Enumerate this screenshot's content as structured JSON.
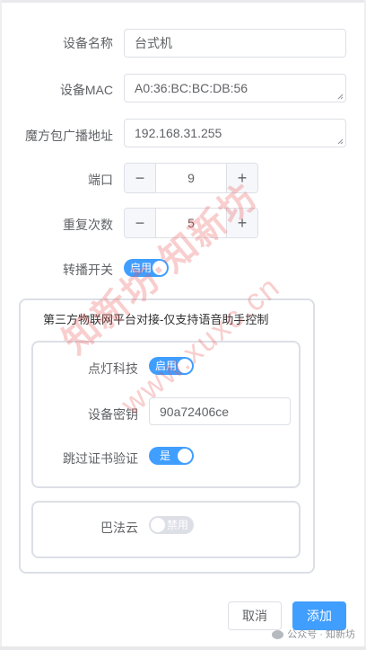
{
  "form": {
    "device_name": {
      "label": "设备名称",
      "value": "台式机"
    },
    "device_mac": {
      "label": "设备MAC",
      "value": "A0:36:BC:BC:DB:56"
    },
    "broadcast": {
      "label": "魔方包广播地址",
      "value": "192.168.31.255"
    },
    "port": {
      "label": "端口",
      "value": "9",
      "minus": "−",
      "plus": "+"
    },
    "repeat": {
      "label": "重复次数",
      "value": "5",
      "minus": "−",
      "plus": "+"
    },
    "relay_switch": {
      "label": "转播开关",
      "state_text": "启用",
      "on": true
    }
  },
  "third_party": {
    "legend": "第三方物联网平台对接-仅支持语音助手控制",
    "diandeng": {
      "label": "点灯科技",
      "switch_text": "启用",
      "on": true,
      "secret_label": "设备密钥",
      "secret_value": "90a72406ce",
      "skip_cert_label": "跳过证书验证",
      "skip_cert_text": "是",
      "skip_cert_on": true
    },
    "bafa": {
      "label": "巴法云",
      "switch_text": "禁用",
      "on": false
    }
  },
  "footer": {
    "cancel_label": "取消",
    "add_label": "添加"
  },
  "watermark": {
    "line1": "知新坊·知新坊",
    "line2": "www.xuxc.cn"
  },
  "credit": {
    "text": "公众号 · 知新坊"
  },
  "colors": {
    "primary": "#409eff",
    "border": "#dcdfe6",
    "text": "#606266",
    "watermark": "#eb5050"
  }
}
